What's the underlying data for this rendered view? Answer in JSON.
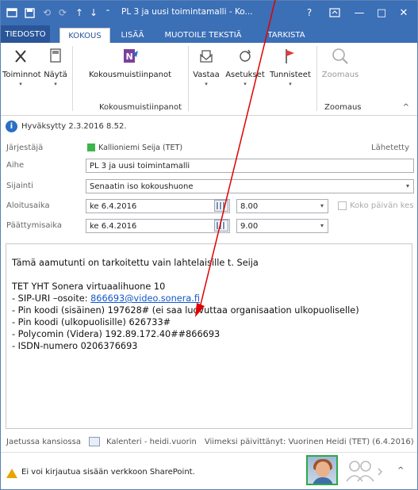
{
  "titlebar": {
    "title": "PL 3 ja uusi toimintamalli - Ko...",
    "help": "?",
    "minimize": "—",
    "restore": "□",
    "close": "✕"
  },
  "tabs": [
    {
      "label": "TIEDOSTO"
    },
    {
      "label": "KOKOUS"
    },
    {
      "label": "LISÄÄ"
    },
    {
      "label": "MUOTOILE TEKSTIÄ"
    },
    {
      "label": "TARKISTA"
    }
  ],
  "ribbon": {
    "buttons": [
      {
        "label": "Toiminnot"
      },
      {
        "label": "Näytä"
      },
      {
        "label": "Kokousmuistiinpanot"
      },
      {
        "label": "Vastaa"
      },
      {
        "label": "Asetukset"
      },
      {
        "label": "Tunnisteet"
      },
      {
        "label": "Zoomaus"
      }
    ],
    "groups": {
      "notes": "Kokousmuistiinpanot",
      "zoom": "Zoomaus"
    },
    "collapse": "^"
  },
  "info": {
    "text": "Hyväksytty 2.3.2016 8.52."
  },
  "form": {
    "organizer_label": "Järjestäjä",
    "organizer_value": "Kallioniemi Seija (TET)",
    "sent_label": "Lähetetty",
    "subject_label": "Aihe",
    "subject_value": "PL 3 ja uusi toimintamalli",
    "location_label": "Sijainti",
    "location_value": "Senaatin iso kokoushuone",
    "start_label": "Aloitusaika",
    "start_date": "ke 6.4.2016",
    "start_time": "8.00",
    "allday_label": "Koko päivän kes",
    "end_label": "Päättymisaika",
    "end_date": "ke 6.4.2016",
    "end_time": "9.00"
  },
  "body": {
    "line1": "Tämä aamutunti on tarkoitettu vain lahtelaisille t. Seija",
    "line2": "TET YHT Sonera virtuaalihuone 10",
    "line3_prefix": "- SIP-URI –osoite: ",
    "line3_link": "866693@video.sonera.fi",
    "line4": "- Pin koodi (sisäinen) 197628# (ei saa luovuttaa organisaation ulkopuoliselle)",
    "line5": "- Pin koodi (ulkopuolisille) 626733#",
    "line6": "- Polycomin (Videra) 192.89.172.40##866693",
    "line7": "- ISDN-numero 0206376693"
  },
  "status": {
    "folder": "Jaetussa kansiossa",
    "calendar": "Kalenteri - heidi.vuorin",
    "modified": "Viimeksi päivittänyt: Vuorinen Heidi (TET) (6.4.2016)"
  },
  "bottom": {
    "warning": "Ei voi kirjautua sisään verkkoon SharePoint.",
    "expand": "^"
  },
  "colors": {
    "titlebar": "#3b6fb6",
    "annotation": "#e00000",
    "presence": "#2ea84a"
  }
}
